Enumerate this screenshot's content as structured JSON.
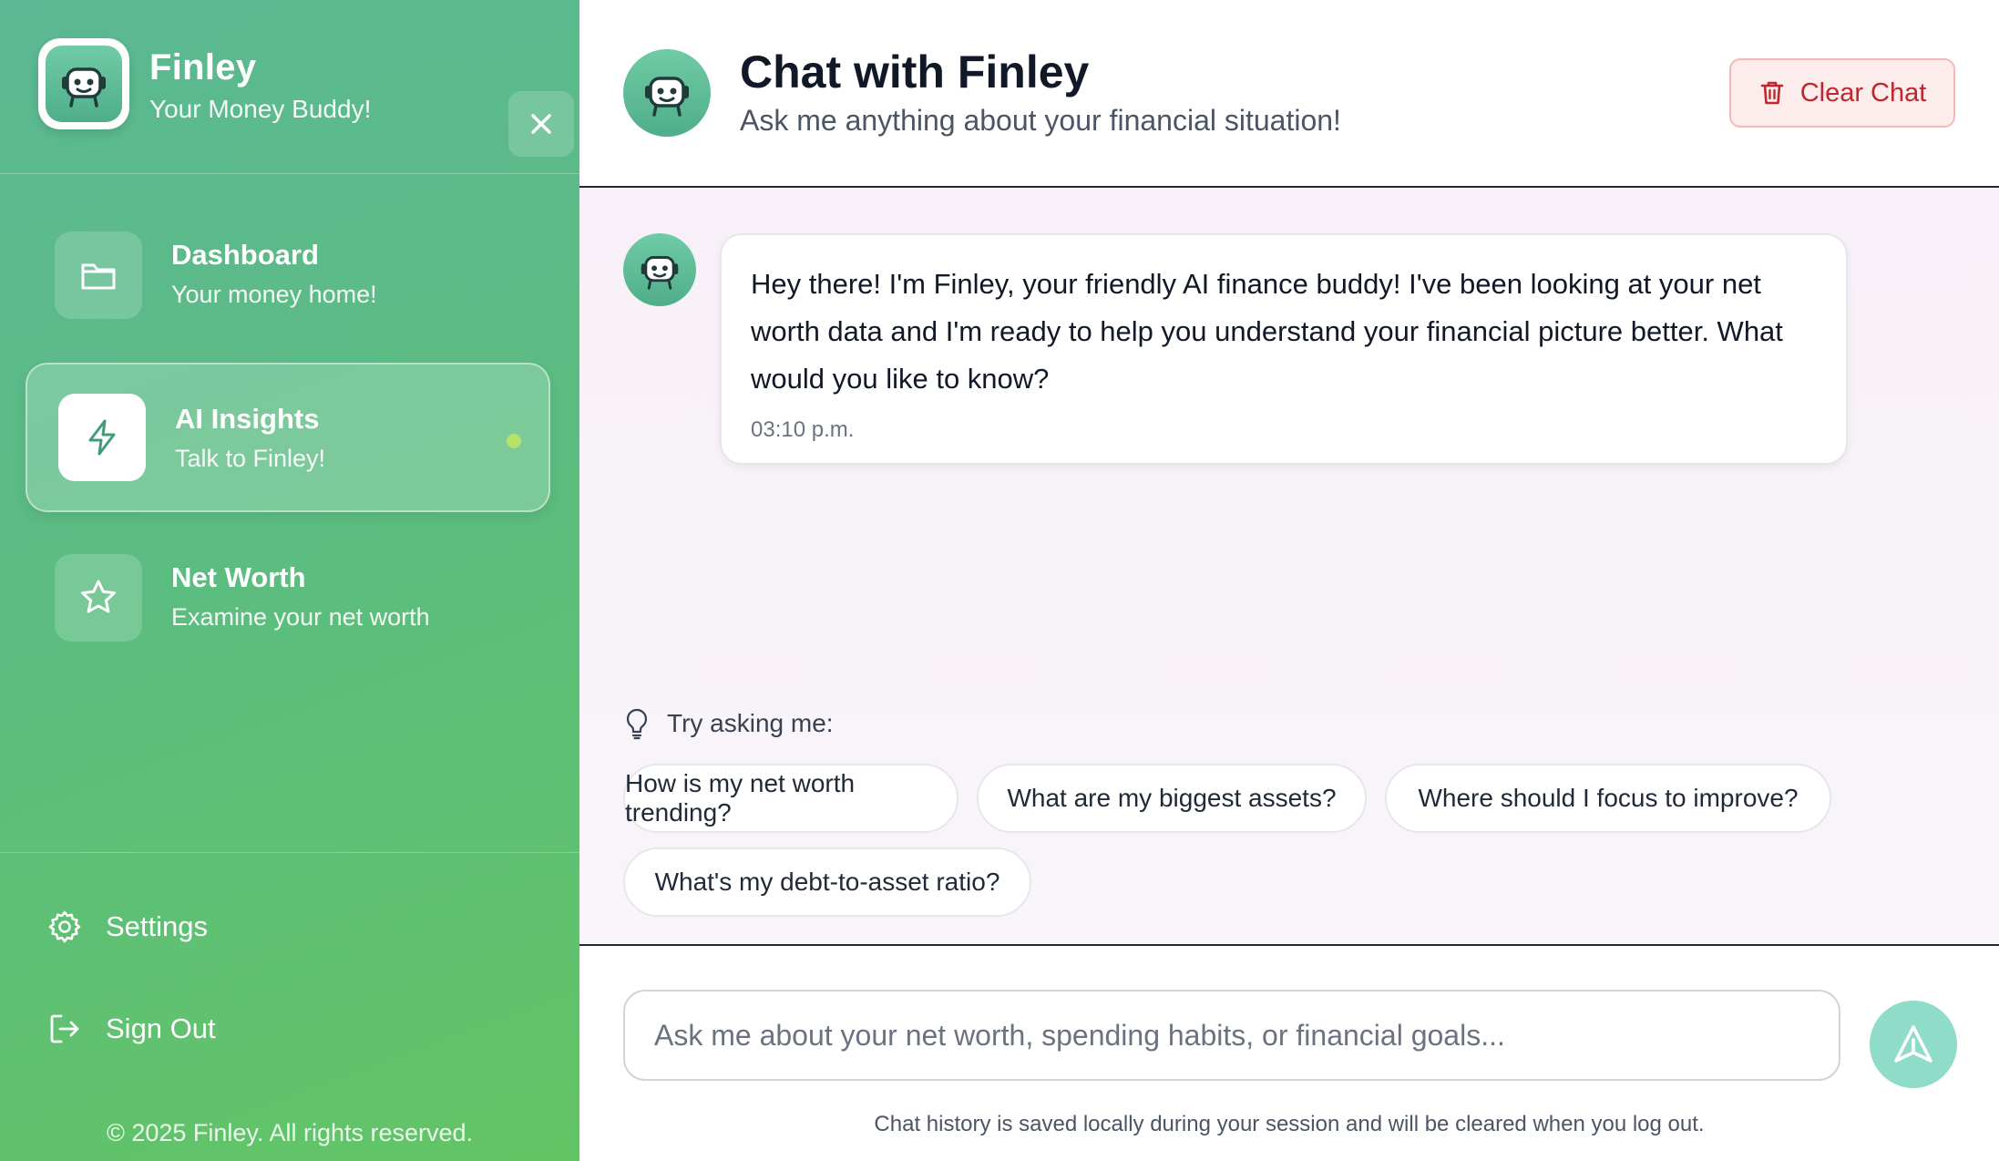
{
  "colors": {
    "sidebar_gradient_start": "#5bb894",
    "sidebar_gradient_end": "#62c564",
    "accent_active_dot": "#b7e26a",
    "clear_chat_text": "#c0262d",
    "clear_chat_bg": "#fdecec",
    "send_button": "#8fdcc8",
    "chat_background": "#f8f0f8"
  },
  "sidebar": {
    "brand": {
      "name": "Finley",
      "tagline": "Your Money Buddy!",
      "logo_icon": "robot-icon",
      "close_icon": "close-icon"
    },
    "nav": [
      {
        "title": "Dashboard",
        "subtitle": "Your money home!",
        "icon": "folder-icon",
        "active": false
      },
      {
        "title": "AI Insights",
        "subtitle": "Talk to Finley!",
        "icon": "lightning-icon",
        "active": true
      },
      {
        "title": "Net Worth",
        "subtitle": "Examine your net worth",
        "icon": "star-icon",
        "active": false
      }
    ],
    "bottom_links": [
      {
        "label": "Settings",
        "icon": "gear-icon"
      },
      {
        "label": "Sign Out",
        "icon": "sign-out-icon"
      }
    ],
    "copyright": "© 2025 Finley. All rights reserved."
  },
  "chat": {
    "header": {
      "title": "Chat with Finley",
      "subtitle": "Ask me anything about your financial situation!",
      "clear_label": "Clear Chat",
      "clear_icon": "trash-icon"
    },
    "messages": [
      {
        "sender": "Finley",
        "text": "Hey there! I'm Finley, your friendly AI finance buddy! I've been looking at your net worth data and I'm ready to help you understand your financial picture better. What would you like to know?",
        "time": "03:10 p.m."
      }
    ],
    "suggestions": {
      "label": "Try asking me:",
      "icon": "lightbulb-icon",
      "items": [
        "How is my net worth trending?",
        "What are my biggest assets?",
        "Where should I focus to improve?",
        "What's my debt-to-asset ratio?"
      ]
    },
    "composer": {
      "value": "",
      "placeholder": "Ask me about your net worth, spending habits, or financial goals...",
      "send_icon": "send-icon",
      "footnote": "Chat history is saved locally during your session and will be cleared when you log out."
    }
  }
}
